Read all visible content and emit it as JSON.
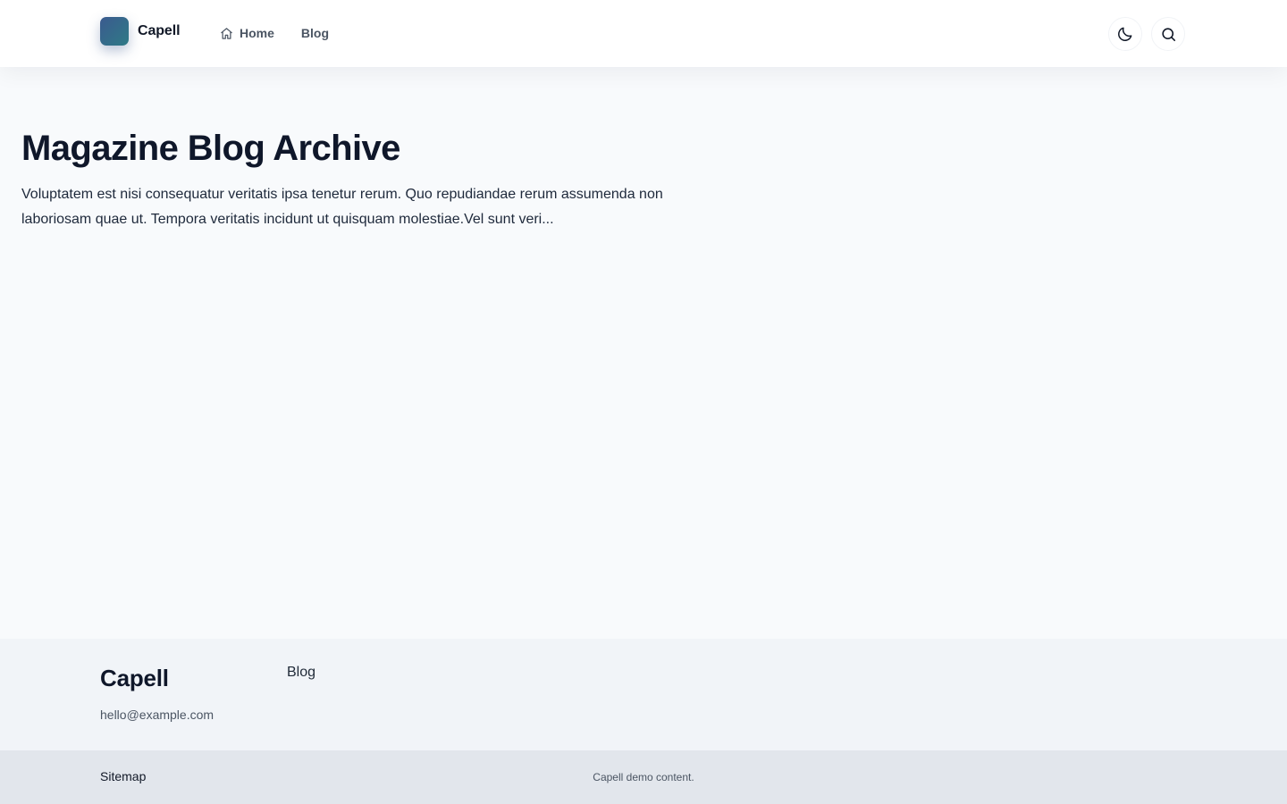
{
  "header": {
    "brand": "Capell",
    "nav": [
      {
        "label": "Home",
        "icon": "home-icon"
      },
      {
        "label": "Blog"
      }
    ],
    "actions": [
      {
        "icon": "moon-icon",
        "purpose": "theme toggle"
      },
      {
        "icon": "search-icon",
        "purpose": "search"
      }
    ]
  },
  "hero": {
    "title": "Magazine Blog Archive",
    "description": "Voluptatem est nisi consequatur veritatis ipsa tenetur rerum. Quo repudiandae rerum assumenda non laboriosam quae ut. Tempora veritatis incidunt ut quisquam molestiae.Vel sunt veri..."
  },
  "footer": {
    "brand": "Capell",
    "email": "hello@example.com",
    "links": [
      {
        "label": "Blog"
      }
    ]
  },
  "subfooter": {
    "sitemap": "Sitemap",
    "copyright": "Capell demo content."
  },
  "colors": {
    "brand_gradient_start": "#3b5a8f",
    "brand_gradient_end": "#2f7a86",
    "page_bg": "#f8fafc",
    "footer_bg": "#f1f4f8",
    "subfooter_bg": "#e2e6ec"
  }
}
